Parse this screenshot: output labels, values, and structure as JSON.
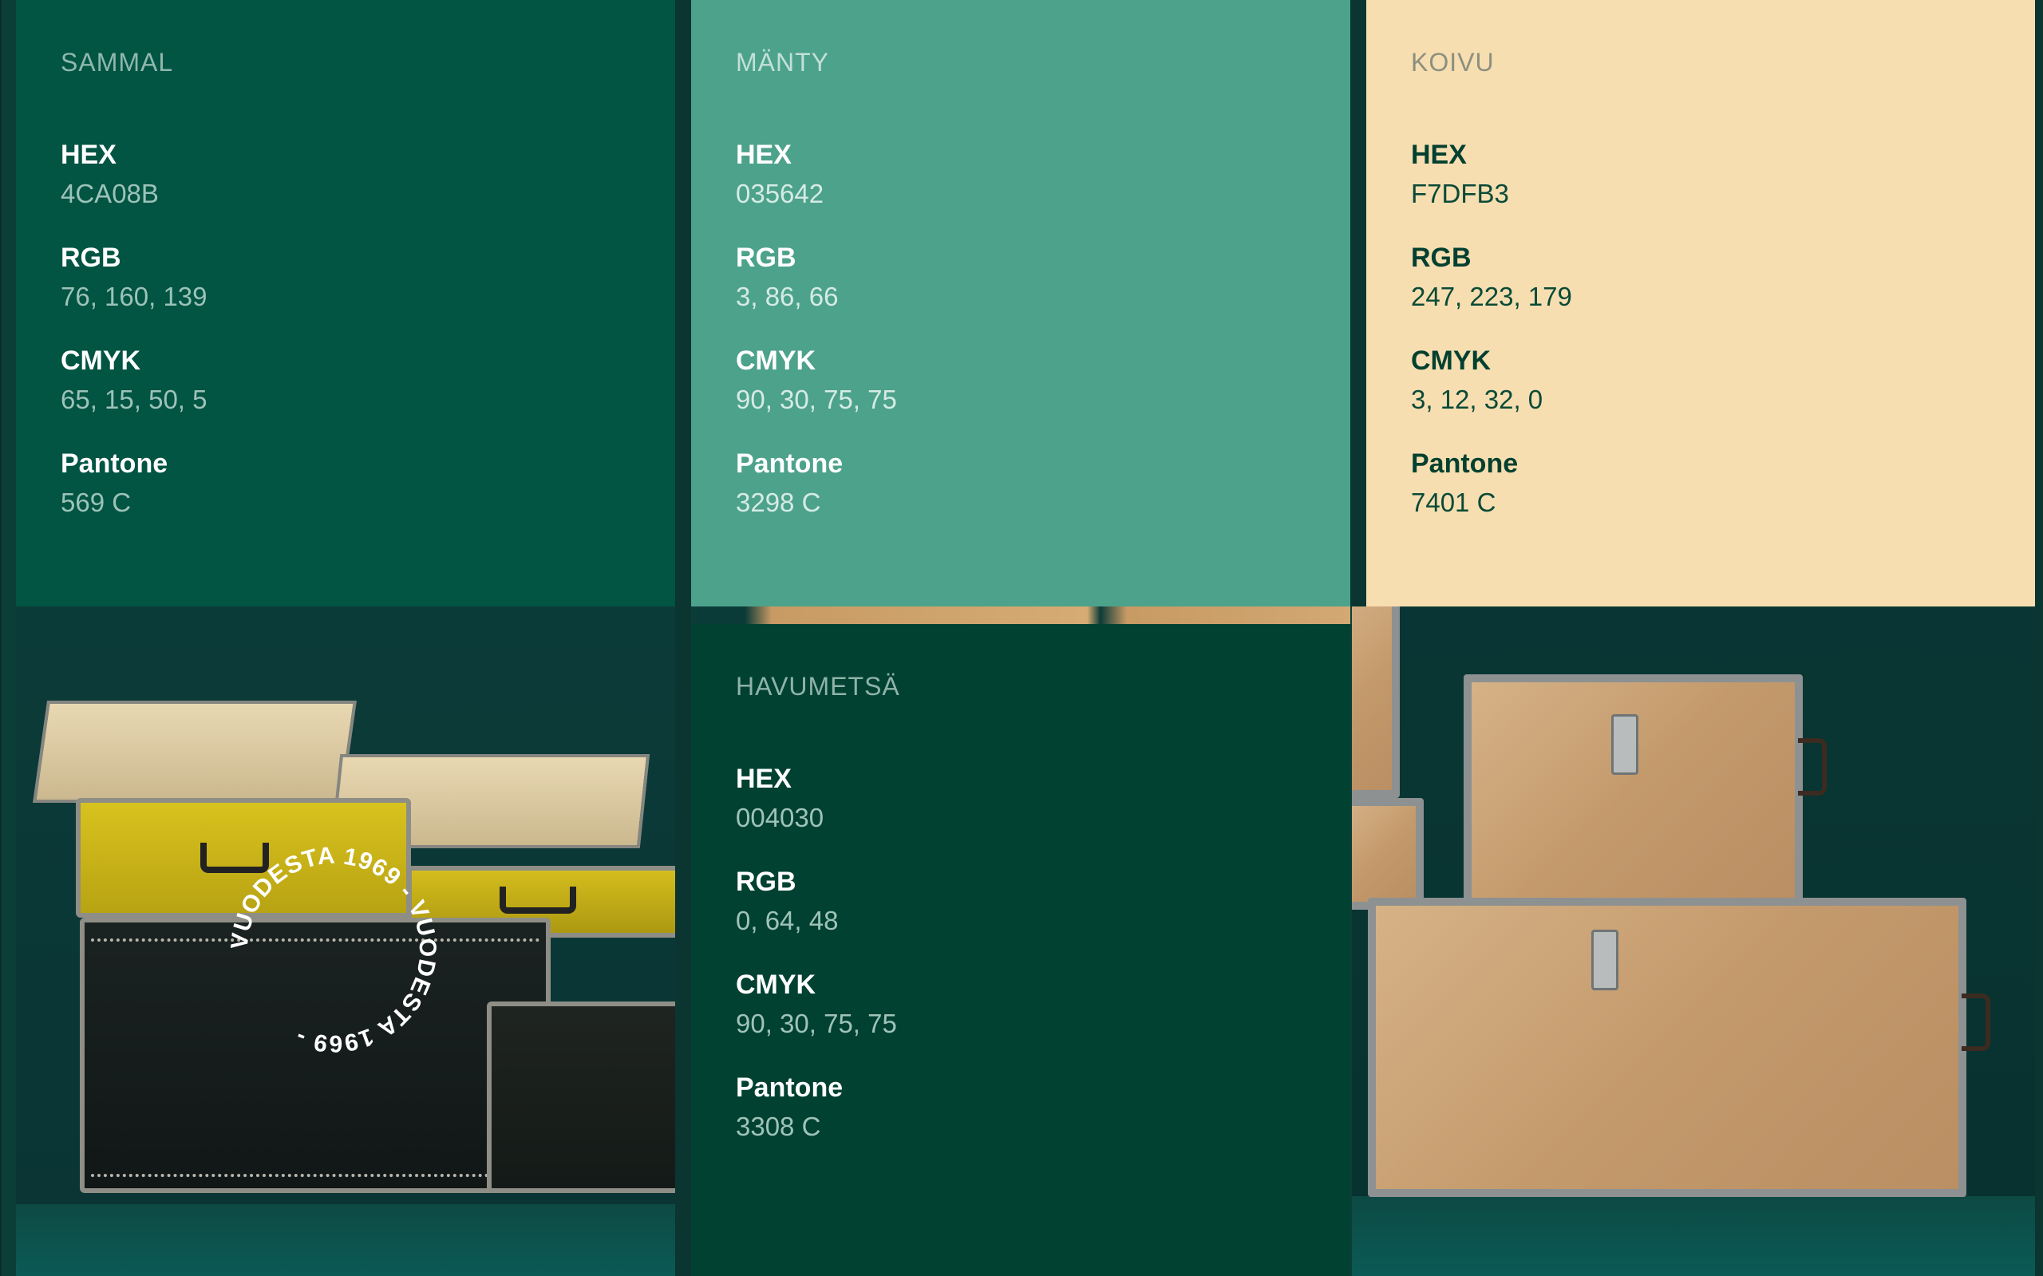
{
  "swatches": {
    "sammal": {
      "name": "SAMMAL",
      "hex_label": "HEX",
      "hex": "4CA08B",
      "rgb_label": "RGB",
      "rgb": "76, 160, 139",
      "cmyk_label": "CMYK",
      "cmyk": "65, 15, 50, 5",
      "pantone_label": "Pantone",
      "pantone": "569 C",
      "bg": "#025443",
      "name_color": "#8fb8ad",
      "label_color": "#ffffff",
      "value_color": "#9cc3b8"
    },
    "manty": {
      "name": "MÄNTY",
      "hex_label": "HEX",
      "hex": "035642",
      "rgb_label": "RGB",
      "rgb": "3, 86, 66",
      "cmyk_label": "CMYK",
      "cmyk": "90, 30, 75, 75",
      "pantone_label": "Pantone",
      "pantone": "3298 C",
      "bg": "#4da28b",
      "name_color": "#c3e0d7",
      "label_color": "#ffffff",
      "value_color": "#d6ebe4"
    },
    "koivu": {
      "name": "KOIVU",
      "hex_label": "HEX",
      "hex": "F7DFB3",
      "rgb_label": "RGB",
      "rgb": "247, 223, 179",
      "cmyk_label": "CMYK",
      "cmyk": "3, 12, 32, 0",
      "pantone_label": "Pantone",
      "pantone": "7401 C",
      "bg": "#f6deb1",
      "name_color": "#8c8f7e",
      "label_color": "#04402f",
      "value_color": "#0a4a36"
    },
    "havumetsa": {
      "name": "HAVUMETSÄ",
      "hex_label": "HEX",
      "hex": "004030",
      "rgb_label": "RGB",
      "rgb": "0, 64, 48",
      "cmyk_label": "CMYK",
      "cmyk": "90, 30, 75, 75",
      "pantone_label": "Pantone",
      "pantone": "3308 C",
      "bg": "#004131",
      "name_color": "#8fb3a8",
      "label_color": "#ffffff",
      "value_color": "#9fc3b8"
    }
  },
  "badge": {
    "text": "VUODESTA 1969 - VUODESTA 1969 - "
  },
  "images": {
    "left_photo": "trunks-photo",
    "right_photo": "wooden-boxes-photo"
  }
}
